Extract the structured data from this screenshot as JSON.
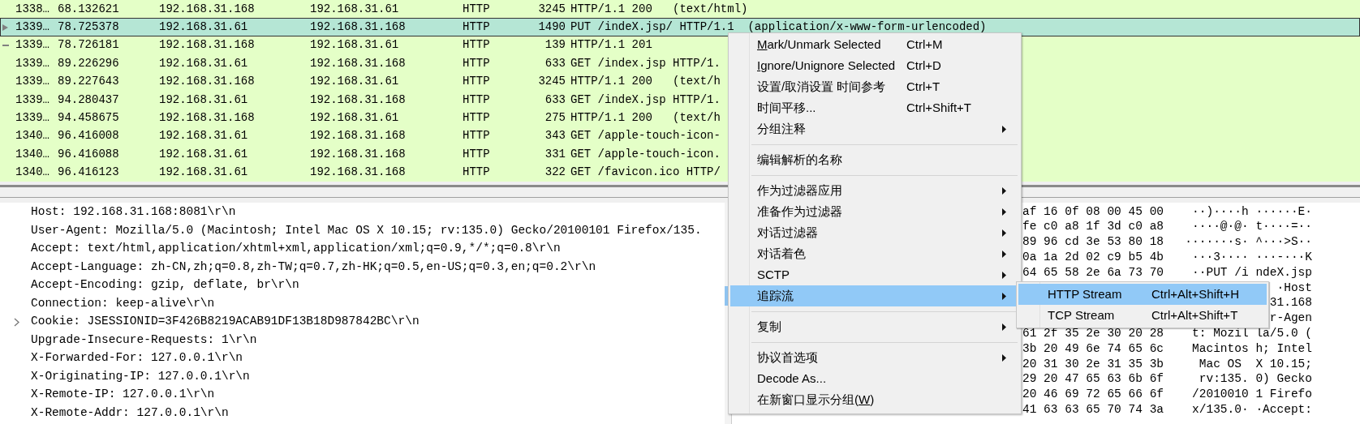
{
  "packets": [
    {
      "kind": "plain",
      "selected": false,
      "no": "1338…",
      "time": "68.132621",
      "source": "192.168.31.168",
      "destination": "192.168.31.61",
      "protocol": "HTTP",
      "length": "3245",
      "info": "HTTP/1.1 200   (text/html)"
    },
    {
      "kind": "arrow",
      "selected": true,
      "no": "1339…",
      "time": "78.725378",
      "source": "192.168.31.61",
      "destination": "192.168.31.168",
      "protocol": "HTTP",
      "length": "1490",
      "info": "PUT /indeX.jsp/ HTTP/1.1  (application/x-www-form-urlencoded)"
    },
    {
      "kind": "dash",
      "selected": false,
      "no": "1339…",
      "time": "78.726181",
      "source": "192.168.31.168",
      "destination": "192.168.31.61",
      "protocol": "HTTP",
      "length": "139",
      "info": "HTTP/1.1 201"
    },
    {
      "kind": "plain",
      "selected": false,
      "no": "1339…",
      "time": "89.226296",
      "source": "192.168.31.61",
      "destination": "192.168.31.168",
      "protocol": "HTTP",
      "length": "633",
      "info": "GET /index.jsp HTTP/1."
    },
    {
      "kind": "plain",
      "selected": false,
      "no": "1339…",
      "time": "89.227643",
      "source": "192.168.31.168",
      "destination": "192.168.31.61",
      "protocol": "HTTP",
      "length": "3245",
      "info": "HTTP/1.1 200   (text/h"
    },
    {
      "kind": "plain",
      "selected": false,
      "no": "1339…",
      "time": "94.280437",
      "source": "192.168.31.61",
      "destination": "192.168.31.168",
      "protocol": "HTTP",
      "length": "633",
      "info": "GET /indeX.jsp HTTP/1."
    },
    {
      "kind": "plain",
      "selected": false,
      "no": "1339…",
      "time": "94.458675",
      "source": "192.168.31.168",
      "destination": "192.168.31.61",
      "protocol": "HTTP",
      "length": "275",
      "info": "HTTP/1.1 200   (text/h"
    },
    {
      "kind": "plain",
      "selected": false,
      "no": "1340…",
      "time": "96.416008",
      "source": "192.168.31.61",
      "destination": "192.168.31.168",
      "protocol": "HTTP",
      "length": "343",
      "info": "GET /apple-touch-icon-"
    },
    {
      "kind": "plain",
      "selected": false,
      "no": "1340…",
      "time": "96.416088",
      "source": "192.168.31.61",
      "destination": "192.168.31.168",
      "protocol": "HTTP",
      "length": "331",
      "info": "GET /apple-touch-icon."
    },
    {
      "kind": "plain",
      "selected": false,
      "no": "1340…",
      "time": "96.416123",
      "source": "192.168.31.61",
      "destination": "192.168.31.168",
      "protocol": "HTTP",
      "length": "322",
      "info": "GET /favicon.ico HTTP/"
    }
  ],
  "details": [
    {
      "kind": "plain",
      "text": "Host: 192.168.31.168:8081\\r\\n"
    },
    {
      "kind": "plain",
      "text": "User-Agent: Mozilla/5.0 (Macintosh; Intel Mac OS X 10.15; rv:135.0) Gecko/20100101 Firefox/135."
    },
    {
      "kind": "plain",
      "text": "Accept: text/html,application/xhtml+xml,application/xml;q=0.9,*/*;q=0.8\\r\\n"
    },
    {
      "kind": "plain",
      "text": "Accept-Language: zh-CN,zh;q=0.8,zh-TW;q=0.7,zh-HK;q=0.5,en-US;q=0.3,en;q=0.2\\r\\n"
    },
    {
      "kind": "plain",
      "text": "Accept-Encoding: gzip, deflate, br\\r\\n"
    },
    {
      "kind": "plain",
      "text": "Connection: keep-alive\\r\\n"
    },
    {
      "kind": "expandable",
      "expanded": false,
      "text": "Cookie: JSESSIONID=3F426B8219ACAB91DF13B18D987842BC\\r\\n"
    },
    {
      "kind": "plain",
      "text": "Upgrade-Insecure-Requests: 1\\r\\n"
    },
    {
      "kind": "plain",
      "text": "X-Forwarded-For: 127.0.0.1\\r\\n"
    },
    {
      "kind": "plain",
      "text": "X-Originating-IP: 127.0.0.1\\r\\n"
    },
    {
      "kind": "plain",
      "text": "X-Remote-IP: 127.0.0.1\\r\\n"
    },
    {
      "kind": "plain",
      "text": "X-Remote-Addr: 127.0.0.1\\r\\n"
    }
  ],
  "hex_rows": [
    {
      "hex": "af 16 0f 08 00 45 00",
      "ascii": "··)····h ······E·"
    },
    {
      "hex": "fe c0 a8 1f 3d c0 a8",
      "ascii": "····@·@· t····=··"
    },
    {
      "hex": "89 96 cd 3e 53 80 18",
      "ascii": "·······s· ^···>S··"
    },
    {
      "hex": "0a 1a 2d 02 c9 b5 4b",
      "ascii": "···3···· ···-···K"
    },
    {
      "hex": "64 65 58 2e 6a 73 70",
      "ascii": "··PUT /i ndeX.jsp"
    },
    {
      "ascii": "·Host"
    },
    {
      "ascii": "31.168"
    },
    {
      "ascii": "r-Agen"
    },
    {
      "hex": "61 2f 35 2e 30 20 28",
      "ascii": "t: Mozil la/5.0 ("
    },
    {
      "hex": "3b 20 49 6e 74 65 6c",
      "ascii": "Macintos h; Intel"
    },
    {
      "hex": "20 31 30 2e 31 35 3b",
      "ascii": " Mac OS  X 10.15;"
    },
    {
      "hex": "29 20 47 65 63 6b 6f",
      "ascii": " rv:135. 0) Gecko"
    },
    {
      "hex": "20 46 69 72 65 66 6f",
      "ascii": "/2010010 1 Firefo"
    },
    {
      "hex": "41 63 63 65 70 74 3a",
      "ascii": "x/135.0· ·Accept:"
    }
  ],
  "context_menu": {
    "items": [
      {
        "kind": "item",
        "label_parts": [
          {
            "s": "M",
            "underline": true
          },
          {
            "s": "ark/Unmark Selected",
            "underline": false
          }
        ],
        "shortcut": "Ctrl+M",
        "submenu": false,
        "selected": false
      },
      {
        "kind": "item",
        "label_parts": [
          {
            "s": "I",
            "underline": true
          },
          {
            "s": "gnore/Unignore Selected",
            "underline": false
          }
        ],
        "shortcut": "Ctrl+D",
        "submenu": false,
        "selected": false
      },
      {
        "kind": "item",
        "label": "设置/取消设置 时间参考",
        "shortcut": "Ctrl+T",
        "submenu": false,
        "selected": false
      },
      {
        "kind": "item",
        "label": "时间平移...",
        "shortcut": "Ctrl+Shift+T",
        "submenu": false,
        "selected": false
      },
      {
        "kind": "item",
        "label": "分组注释",
        "submenu": true,
        "selected": false
      },
      {
        "kind": "separator"
      },
      {
        "kind": "item",
        "label": "编辑解析的名称",
        "submenu": false,
        "selected": false
      },
      {
        "kind": "separator"
      },
      {
        "kind": "item",
        "label": "作为过滤器应用",
        "submenu": true,
        "selected": false
      },
      {
        "kind": "item",
        "label": "准备作为过滤器",
        "submenu": true,
        "selected": false
      },
      {
        "kind": "item",
        "label": "对话过滤器",
        "submenu": true,
        "selected": false
      },
      {
        "kind": "item",
        "label": "对话着色",
        "submenu": true,
        "selected": false
      },
      {
        "kind": "item",
        "label": "SCTP",
        "submenu": true,
        "selected": false
      },
      {
        "kind": "item",
        "label": "追踪流",
        "submenu": true,
        "selected": true,
        "submenu_items": [
          {
            "label": "HTTP Stream",
            "shortcut": "Ctrl+Alt+Shift+H",
            "selected": true
          },
          {
            "label": "TCP Stream",
            "shortcut": "Ctrl+Alt+Shift+T",
            "selected": false
          }
        ]
      },
      {
        "kind": "separator"
      },
      {
        "kind": "item",
        "label": "复制",
        "submenu": true,
        "selected": false
      },
      {
        "kind": "separator"
      },
      {
        "kind": "item",
        "label": "协议首选项",
        "submenu": true,
        "selected": false
      },
      {
        "kind": "item",
        "label": "Decode As...",
        "submenu": false,
        "selected": false
      },
      {
        "kind": "item",
        "label_parts": [
          {
            "s": "在新窗口显示分组(",
            "underline": false
          },
          {
            "s": "W",
            "underline": true
          },
          {
            "s": ")",
            "underline": false
          }
        ],
        "submenu": false,
        "selected": false
      }
    ]
  }
}
